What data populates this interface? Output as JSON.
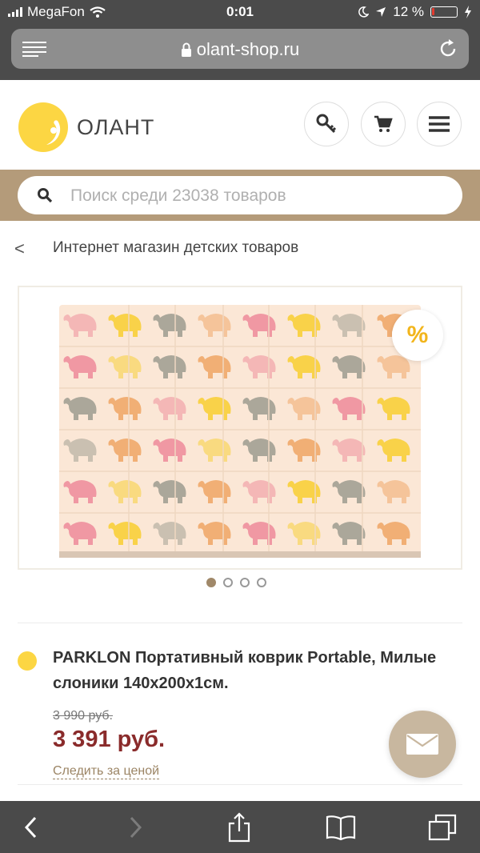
{
  "status_bar": {
    "carrier": "MegaFon",
    "time": "0:01",
    "battery_percent": "12 %",
    "battery_level": 0.12
  },
  "browser": {
    "url": "olant-shop.ru"
  },
  "header": {
    "logo_text": "ОЛАНТ",
    "icons": [
      "key-icon",
      "cart-icon",
      "menu-icon"
    ]
  },
  "search": {
    "placeholder": "Поиск среди 23038 товаров"
  },
  "breadcrumb": {
    "back_symbol": "<",
    "label": "Интернет магазин детских товаров"
  },
  "gallery": {
    "discount_symbol": "%",
    "slide_count": 4,
    "active_slide": 1,
    "colors": {
      "pink": "#ee8f9d",
      "yellow": "#f8cf3a",
      "gray": "#a2a094",
      "orange": "#f0a86a",
      "mat": "#fbe7d6"
    }
  },
  "product": {
    "title": "PARKLON Портативный коврик Portable, Милые слоники 140х200х1см.",
    "old_price": "3 990 руб.",
    "price": "3 391 руб.",
    "follow_label": "Следить за ценой",
    "bullet_color": "#fcd643"
  },
  "toolbar": {
    "icons": [
      "back-icon",
      "forward-icon",
      "share-icon",
      "bookmarks-icon",
      "tabs-icon"
    ]
  }
}
